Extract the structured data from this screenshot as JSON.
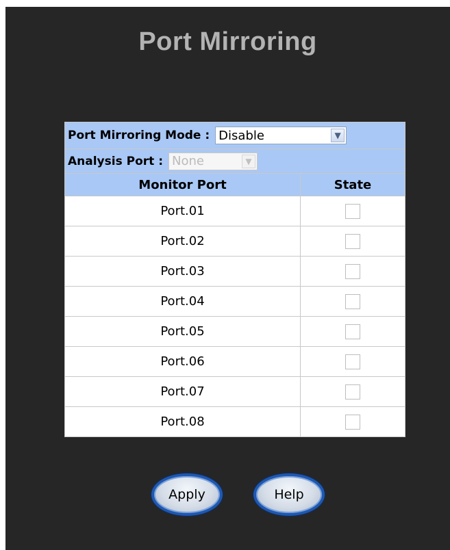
{
  "title": "Port Mirroring",
  "mode": {
    "label": "Port Mirroring Mode :",
    "value": "Disable"
  },
  "analysis": {
    "label": "Analysis Port :",
    "value": "None"
  },
  "table": {
    "headers": [
      "Monitor Port",
      "State"
    ],
    "rows": [
      {
        "port": "Port.01",
        "checked": false
      },
      {
        "port": "Port.02",
        "checked": false
      },
      {
        "port": "Port.03",
        "checked": false
      },
      {
        "port": "Port.04",
        "checked": false
      },
      {
        "port": "Port.05",
        "checked": false
      },
      {
        "port": "Port.06",
        "checked": false
      },
      {
        "port": "Port.07",
        "checked": false
      },
      {
        "port": "Port.08",
        "checked": false
      }
    ]
  },
  "buttons": {
    "apply": "Apply",
    "help": "Help"
  },
  "colors": {
    "panel_bg": "#262626",
    "title_text": "#b3b3b3",
    "header_bg": "#a9c8f5",
    "button_ring": "#1f58b0"
  }
}
